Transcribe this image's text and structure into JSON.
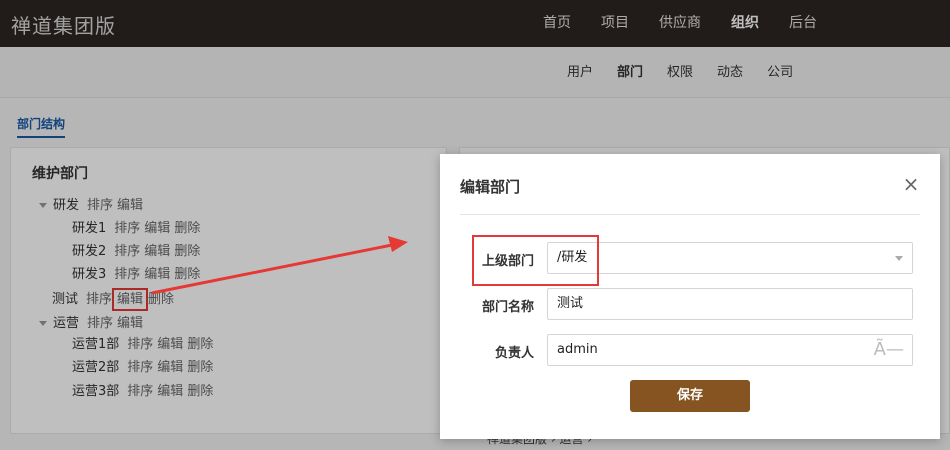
{
  "app": {
    "brand": "禅道集团版"
  },
  "topnav": [
    {
      "label": "首页",
      "active": false
    },
    {
      "label": "项目",
      "active": false
    },
    {
      "label": "供应商",
      "active": false
    },
    {
      "label": "组织",
      "active": true
    },
    {
      "label": "后台",
      "active": false
    }
  ],
  "subnav": [
    {
      "label": "用户",
      "active": false
    },
    {
      "label": "部门",
      "active": true
    },
    {
      "label": "权限",
      "active": false
    },
    {
      "label": "动态",
      "active": false
    },
    {
      "label": "公司",
      "active": false
    }
  ],
  "tab": {
    "label": "部门结构"
  },
  "panel": {
    "title": "维护部门",
    "tree": [
      {
        "name": "研发",
        "actions": [
          "排序",
          "编辑"
        ],
        "expanded": true,
        "level": 0
      },
      {
        "name": "研发1",
        "actions": [
          "排序",
          "编辑",
          "删除"
        ],
        "level": 1
      },
      {
        "name": "研发2",
        "actions": [
          "排序",
          "编辑",
          "删除"
        ],
        "level": 1
      },
      {
        "name": "研发3",
        "actions": [
          "排序",
          "编辑",
          "删除"
        ],
        "level": 1
      },
      {
        "name": "测试",
        "actions": [
          "排序",
          "编辑",
          "删除"
        ],
        "level": 0
      },
      {
        "name": "运营",
        "actions": [
          "排序",
          "编辑"
        ],
        "expanded": true,
        "level": 0
      },
      {
        "name": "运营1部",
        "actions": [
          "排序",
          "编辑",
          "删除"
        ],
        "level": 1
      },
      {
        "name": "运营2部",
        "actions": [
          "排序",
          "编辑",
          "删除"
        ],
        "level": 1
      },
      {
        "name": "运营3部",
        "actions": [
          "排序",
          "编辑",
          "删除"
        ],
        "level": 1
      }
    ]
  },
  "breadcrumb": {
    "text": "禅道集团版  ›  运营  ›"
  },
  "modal": {
    "title": "编辑部门",
    "close_icon": "×",
    "fields": {
      "parent": {
        "label": "上级部门",
        "value": "/研发"
      },
      "name": {
        "label": "部门名称",
        "value": "测试"
      },
      "manager": {
        "label": "负责人",
        "value": "admin",
        "icon": "Ã—"
      }
    },
    "save_label": "保存"
  },
  "colors": {
    "topbar": "#2d2522",
    "accent": "#1a5aa6",
    "save_button": "#855420",
    "highlight": "#e53935"
  }
}
